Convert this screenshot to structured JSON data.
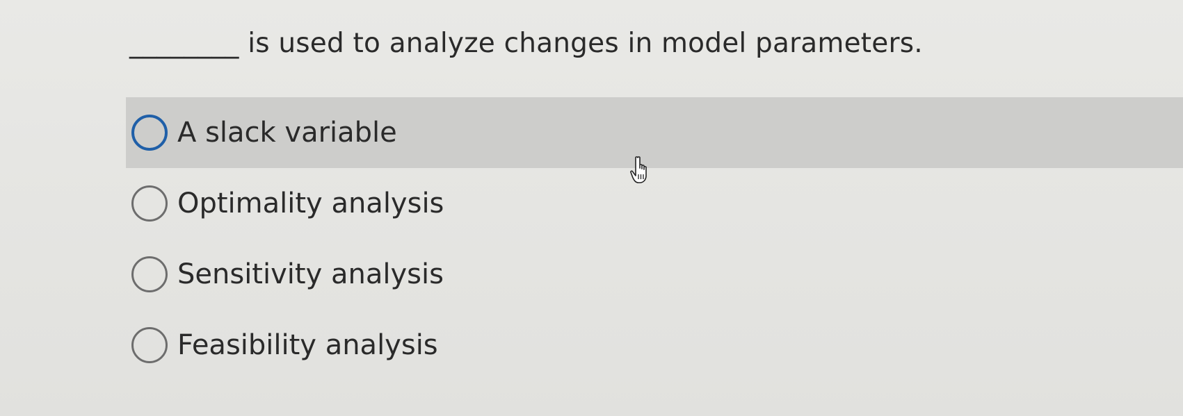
{
  "question": {
    "blank": "________",
    "text": "is used to analyze changes in model parameters."
  },
  "options": [
    {
      "label": "A slack variable",
      "hovered": true,
      "selected": false
    },
    {
      "label": "Optimality analysis",
      "hovered": false,
      "selected": false
    },
    {
      "label": "Sensitivity analysis",
      "hovered": false,
      "selected": false
    },
    {
      "label": "Feasibility analysis",
      "hovered": false,
      "selected": false
    }
  ],
  "colors": {
    "radio_hover_border": "#1f5fa8",
    "radio_border": "#6d6d6d",
    "hover_row": "#cdcdcb"
  },
  "icons": {
    "cursor": "hand-pointer-icon"
  }
}
